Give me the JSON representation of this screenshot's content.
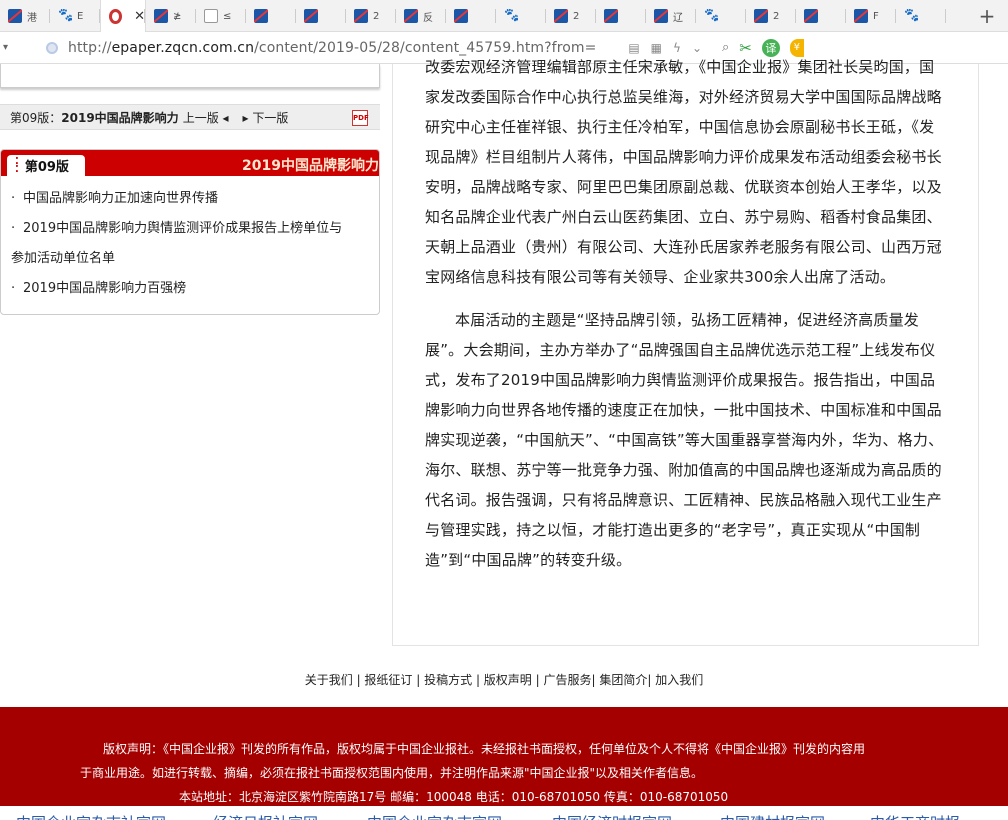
{
  "browser": {
    "tabs": [
      {
        "label": "港",
        "icon": "site-logo-icon"
      },
      {
        "label": "E",
        "icon": "baidu-paw-icon"
      },
      {
        "label": "",
        "icon": "target-icon",
        "active": true,
        "close": "✕"
      },
      {
        "label": "≱",
        "icon": "site-logo-icon"
      },
      {
        "label": "≤",
        "icon": "page-icon"
      },
      {
        "label": "",
        "icon": "site-logo-icon"
      },
      {
        "label": "",
        "icon": "site-logo-icon"
      },
      {
        "label": "2",
        "icon": "site-logo-icon"
      },
      {
        "label": "反",
        "icon": "site-logo-icon"
      },
      {
        "label": "",
        "icon": "site-logo-icon"
      },
      {
        "label": "",
        "icon": "baidu-paw-icon"
      },
      {
        "label": "2",
        "icon": "site-logo-icon"
      },
      {
        "label": "",
        "icon": "site-logo-icon"
      },
      {
        "label": "辽",
        "icon": "site-logo-icon"
      },
      {
        "label": "",
        "icon": "baidu-paw-icon"
      },
      {
        "label": "2",
        "icon": "site-logo-icon"
      },
      {
        "label": "",
        "icon": "site-logo-icon"
      },
      {
        "label": "F",
        "icon": "site-logo-icon"
      },
      {
        "label": "",
        "icon": "baidu-paw-icon"
      }
    ],
    "new_tab": "+",
    "url_prefix": "http://",
    "url_domain": "epaper.zqcn.com.cn",
    "url_path": "/content/2019-05/28/content_45759.htm?from=",
    "translate_label": "译"
  },
  "breadcrumb": {
    "edition": "第09版：",
    "edition_name": "2019中国品牌影响力",
    "prev": "上一版",
    "next": "下一版"
  },
  "panel": {
    "tab_label": "第09版",
    "title": "2019中国品牌影响力",
    "items": [
      "中国品牌影响力正加速向世界传播",
      "2019中国品牌影响力舆情监测评价成果报告上榜单位与",
      "参加活动单位名单",
      "2019中国品牌影响力百强榜"
    ]
  },
  "article": {
    "paragraph1": "改委宏观经济管理编辑部原主任宋承敏，《中国企业报》集团社长吴昀国，国家发改委国际合作中心执行总监吴维海，对外经济贸易大学中国国际品牌战略研究中心主任崔祥银、执行主任冷柏军，中国信息协会原副秘书长王砥，《发现品牌》栏目组制片人蒋伟，中国品牌影响力评价成果发布活动组委会秘书长安明，品牌战略专家、阿里巴巴集团原副总裁、优联资本创始人王孝华，以及知名品牌企业代表广州白云山医药集团、立白、苏宁易购、稻香村食品集团、天朝上品酒业（贵州）有限公司、大连孙氏居家养老服务有限公司、山西万冠宝网络信息科技有限公司等有关领导、企业家共300余人出席了活动。",
    "paragraph2": "本届活动的主题是“坚持品牌引领，弘扬工匠精神，促进经济高质量发展”。大会期间，主办方举办了“品牌强国自主品牌优选示范工程”上线发布仪式，发布了2019中国品牌影响力舆情监测评价成果报告。报告指出，中国品牌影响力向世界各地传播的速度正在加快，一批中国技术、中国标准和中国品牌实现逆袭，“中国航天”、“中国高铁”等大国重器享誉海内外，华为、格力、海尔、联想、苏宁等一批竞争力强、附加值高的中国品牌也逐渐成为高品质的代名词。报告强调，只有将品牌意识、工匠精神、民族品格融入现代工业生产与管理实践，持之以恒，才能打造出更多的“老字号”，真正实现从“中国制造”到“中国品牌”的转变升级。"
  },
  "footer": {
    "links": [
      "关于我们",
      "报纸征订",
      "投稿方式",
      "版权声明",
      "广告服务",
      "集团简介",
      "加入我们"
    ],
    "copyright1": "版权声明：《中国企业报》刊发的所有作品，版权均属于中国企业报社。未经报社书面授权，任何单位及个人不得将《中国企业报》刊发的内容用",
    "copyright2": "于商业用途。如进行转载、摘编，必须在报社书面授权范围内使用，并注明作品来源\"中国企业报\"以及相关作者信息。",
    "address": "本站地址：北京海淀区紫竹院南路17号 邮编：100048 电话：010-68701050 传真：010-68701050",
    "partner_links": [
      "中国企业家杂志社官网",
      "经济日报社官网",
      "中国企业家杂志官网",
      "中国经济时报官网",
      "中国建材报官网",
      "中华工商时报"
    ]
  },
  "colors": {
    "brand_red": "#cc0000",
    "footer_red": "#a40000",
    "link_blue": "#2a5caa"
  }
}
